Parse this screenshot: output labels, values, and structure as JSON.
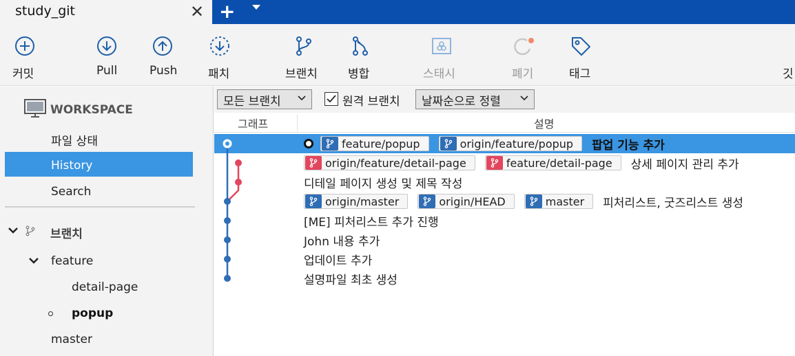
{
  "tab": {
    "title": "study_git",
    "close": "✕",
    "add": "+"
  },
  "toolbar": [
    {
      "label": "커밋",
      "icon": "commit-icon"
    },
    {
      "label": "Pull",
      "icon": "pull-icon"
    },
    {
      "label": "Push",
      "icon": "push-icon"
    },
    {
      "label": "패치",
      "icon": "patch-icon"
    },
    {
      "label": "브랜치",
      "icon": "branch-icon"
    },
    {
      "label": "병합",
      "icon": "merge-icon"
    },
    {
      "label": "스태시",
      "icon": "stash-icon"
    },
    {
      "label": "폐기",
      "icon": "discard-icon"
    },
    {
      "label": "태그",
      "icon": "tag-icon"
    },
    {
      "label": "깃",
      "icon": ""
    }
  ],
  "sidebar": {
    "workspace": "WORKSPACE",
    "file_status": "파일 상태",
    "history": "History",
    "search": "Search",
    "branches_header": "브랜치",
    "feature_folder": "feature",
    "detail_page": "detail-page",
    "popup": "popup",
    "master": "master"
  },
  "filters": {
    "branch_select": "모든 브랜치",
    "remote_label": "원격 브랜치",
    "remote_checked": true,
    "sort_select": "날짜순으로 정렬"
  },
  "columns": {
    "graph": "그래프",
    "description": "설명"
  },
  "colors": {
    "accent": "#3a95e2",
    "tabbar": "#0b4fae",
    "graph_main": "#2f6db5",
    "graph_branch": "#e2465e"
  },
  "commits": [
    {
      "refs": [
        {
          "name": "feature/popup",
          "color": "blue"
        },
        {
          "name": "origin/feature/popup",
          "color": "blue"
        }
      ],
      "message": "팝업 기능 추가"
    },
    {
      "refs": [
        {
          "name": "origin/feature/detail-page",
          "color": "red"
        },
        {
          "name": "feature/detail-page",
          "color": "red"
        }
      ],
      "message": "상세 페이지 관리 추가"
    },
    {
      "refs": [],
      "message": "디테일 페이지 생성 및 제목 작성"
    },
    {
      "refs": [
        {
          "name": "origin/master",
          "color": "blue"
        },
        {
          "name": "origin/HEAD",
          "color": "blue"
        },
        {
          "name": "master",
          "color": "blue"
        }
      ],
      "message": "피처리스트, 굿즈리스트 생성"
    },
    {
      "refs": [],
      "message": "[ME] 피처리스트 추가 진행"
    },
    {
      "refs": [],
      "message": "John 내용 추가"
    },
    {
      "refs": [],
      "message": "업데이트 추가"
    },
    {
      "refs": [],
      "message": "설명파일 최초 생성"
    }
  ]
}
